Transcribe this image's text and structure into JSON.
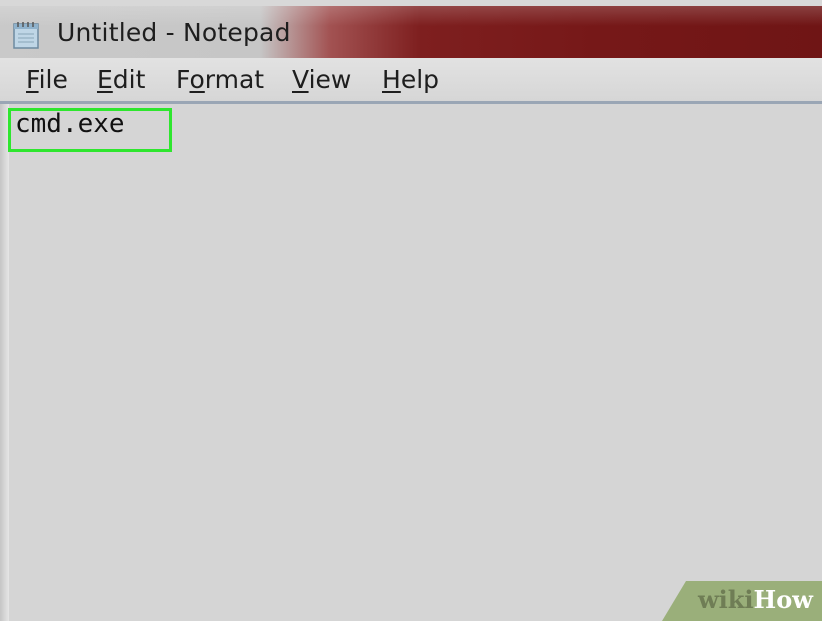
{
  "window": {
    "title": "Untitled - Notepad",
    "icon": "notepad-icon"
  },
  "menu": {
    "items": [
      {
        "accel": "F",
        "rest": "ile"
      },
      {
        "accel": "E",
        "rest": "dit"
      },
      {
        "pre": "F",
        "accel": "o",
        "rest": "rmat"
      },
      {
        "accel": "V",
        "rest": "iew"
      },
      {
        "accel": "H",
        "rest": "elp"
      }
    ]
  },
  "editor": {
    "text": "cmd.exe"
  },
  "watermark": {
    "wiki": "wiki",
    "how": "How"
  },
  "colors": {
    "title_bar_accent": "#761818",
    "highlight": "#2ee62e",
    "editor_background": "#d5d5d5"
  }
}
